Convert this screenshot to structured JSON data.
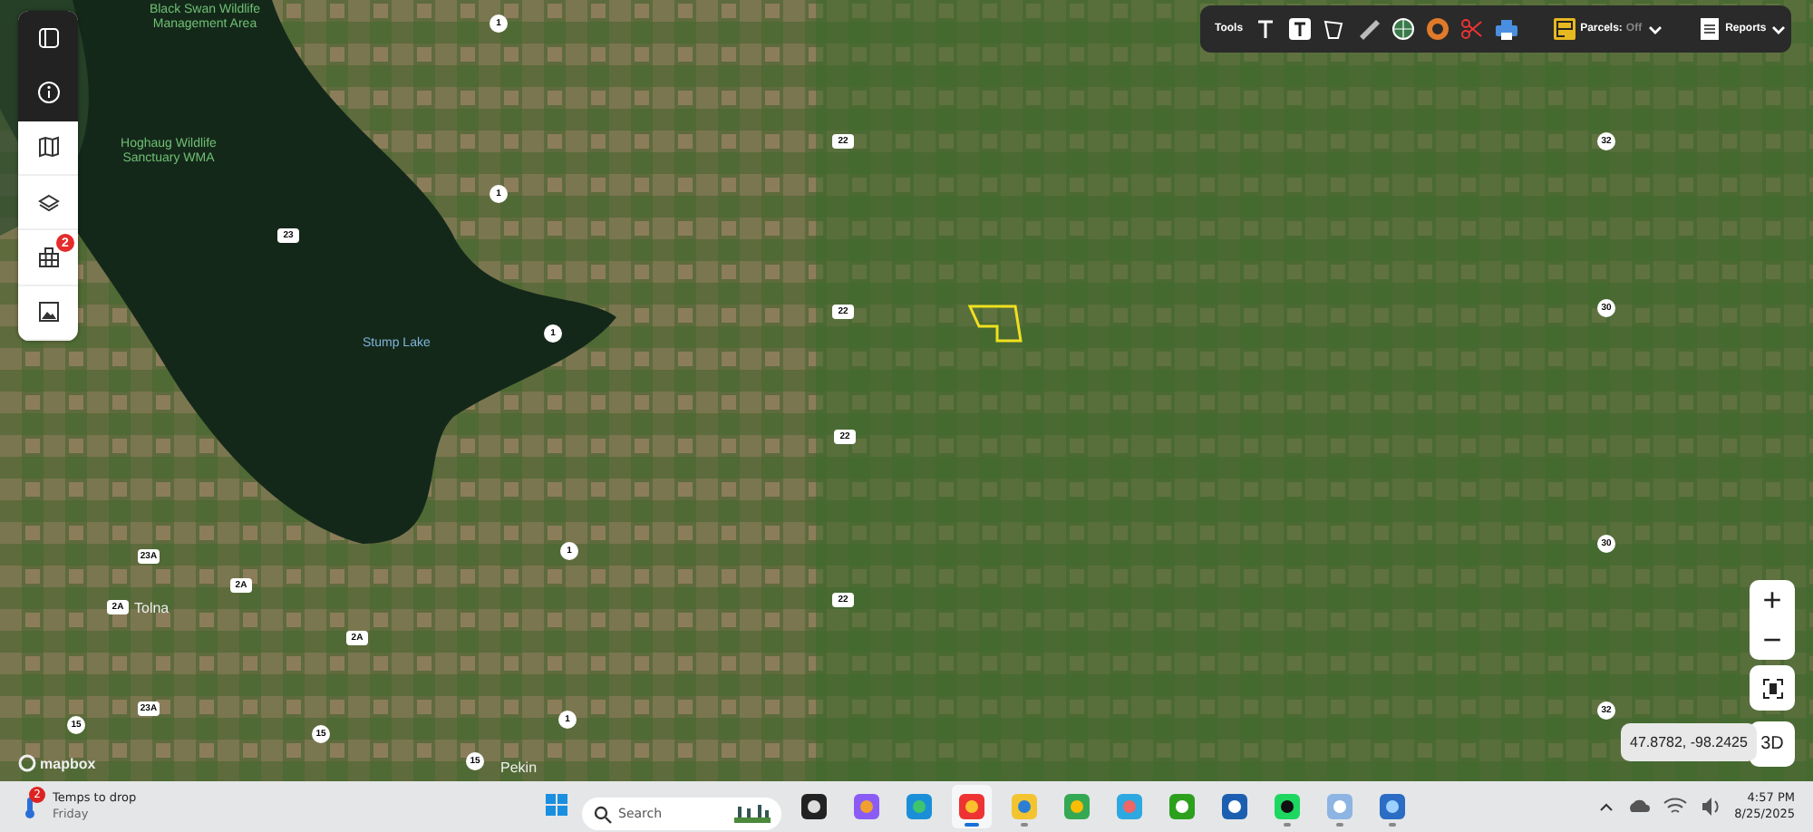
{
  "sidebar": {
    "layers_badge": "2"
  },
  "toolbar": {
    "tools_label": "Tools",
    "parcels_label": "Parcels:",
    "parcels_value": "Off",
    "reports_label": "Reports"
  },
  "map": {
    "labels": [
      {
        "kind": "place",
        "text": "Black Swan Wildlife Management Area"
      },
      {
        "kind": "place",
        "text": "Hoghaug Wildlife Sanctuary WMA"
      },
      {
        "kind": "water",
        "text": "Stump Lake"
      },
      {
        "kind": "town",
        "text": "Tolna"
      },
      {
        "kind": "town",
        "text": "Pekin"
      },
      {
        "kind": "circle",
        "text": "1"
      },
      {
        "kind": "circle",
        "text": "1"
      },
      {
        "kind": "circle",
        "text": "1"
      },
      {
        "kind": "circle",
        "text": "1"
      },
      {
        "kind": "circle",
        "text": "1"
      },
      {
        "kind": "box",
        "text": "22"
      },
      {
        "kind": "box",
        "text": "22"
      },
      {
        "kind": "box",
        "text": "22"
      },
      {
        "kind": "box",
        "text": "22"
      },
      {
        "kind": "box",
        "text": "23"
      },
      {
        "kind": "box",
        "text": "23A"
      },
      {
        "kind": "box",
        "text": "2A"
      },
      {
        "kind": "box",
        "text": "2A"
      },
      {
        "kind": "box",
        "text": "2A"
      },
      {
        "kind": "box",
        "text": "23A"
      },
      {
        "kind": "circle",
        "text": "15"
      },
      {
        "kind": "circle",
        "text": "15"
      },
      {
        "kind": "circle",
        "text": "15"
      },
      {
        "kind": "circle",
        "text": "32"
      },
      {
        "kind": "circle",
        "text": "30"
      },
      {
        "kind": "circle",
        "text": "30"
      },
      {
        "kind": "circle",
        "text": "32"
      }
    ],
    "attribution": "mapbox",
    "coordinates": "47.8782, -98.2425",
    "zoom_in": "+",
    "zoom_out": "−",
    "three_d": "3D"
  },
  "taskbar": {
    "weather": {
      "badge": "2",
      "title": "Temps to drop",
      "subtitle": "Friday"
    },
    "search_placeholder": "Search",
    "apps": [
      {
        "kind": "taskview",
        "running": false,
        "selected": false
      },
      {
        "kind": "copilot",
        "running": false,
        "selected": false
      },
      {
        "kind": "edge",
        "running": false,
        "selected": false
      },
      {
        "kind": "chrome",
        "running": true,
        "selected": true
      },
      {
        "kind": "folder",
        "running": true,
        "selected": false
      },
      {
        "kind": "drive",
        "running": false,
        "selected": false
      },
      {
        "kind": "paint",
        "running": false,
        "selected": false
      },
      {
        "kind": "qb",
        "running": false,
        "selected": false
      },
      {
        "kind": "doc",
        "running": false,
        "selected": false
      },
      {
        "kind": "music",
        "running": true,
        "selected": false
      },
      {
        "kind": "note",
        "running": true,
        "selected": false
      },
      {
        "kind": "photos",
        "running": true,
        "selected": false
      }
    ],
    "time": "4:57 PM",
    "date": "8/25/2025"
  }
}
